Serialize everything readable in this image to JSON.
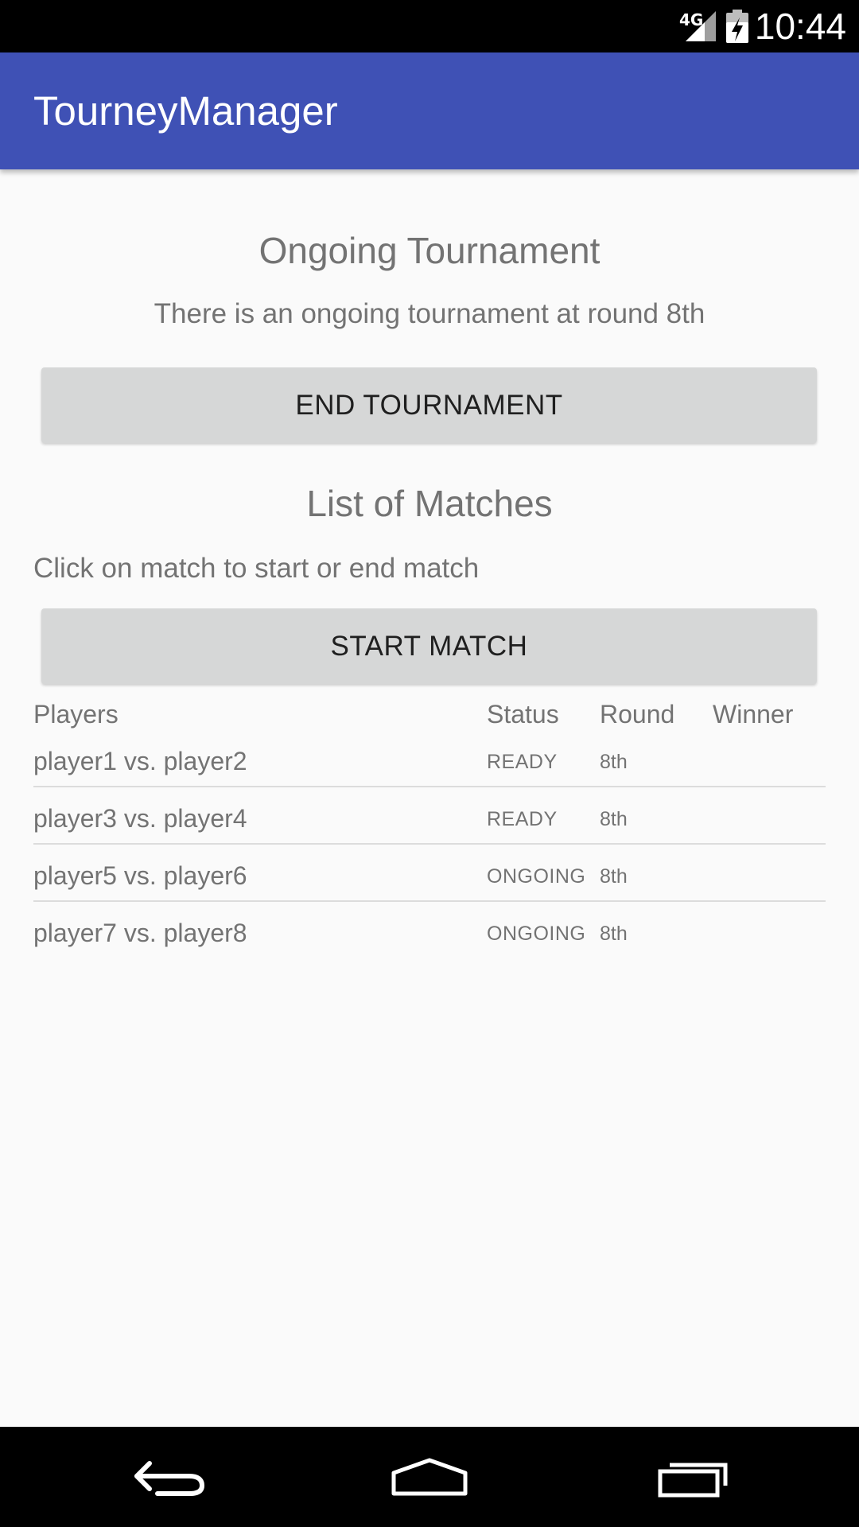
{
  "status_bar": {
    "time": "10:44",
    "network": "4G",
    "icons": [
      "signal-icon",
      "battery-icon"
    ]
  },
  "app_bar": {
    "title": "TourneyManager",
    "color": "#3f51b5"
  },
  "ongoing": {
    "title": "Ongoing Tournament",
    "description": "There is an ongoing tournament at round 8th",
    "end_button_label": "END TOURNAMENT"
  },
  "matches": {
    "title": "List of Matches",
    "hint": "Click on match to start or end match",
    "start_button_label": "START MATCH",
    "columns": {
      "players": "Players",
      "status": "Status",
      "round": "Round",
      "winner": "Winner"
    },
    "rows": [
      {
        "players": "player1 vs. player2",
        "status": "READY",
        "round": "8th",
        "winner": ""
      },
      {
        "players": "player3 vs. player4",
        "status": "READY",
        "round": "8th",
        "winner": ""
      },
      {
        "players": "player5 vs. player6",
        "status": "ONGOING",
        "round": "8th",
        "winner": ""
      },
      {
        "players": "player7 vs. player8",
        "status": "ONGOING",
        "round": "8th",
        "winner": ""
      }
    ]
  },
  "nav_bar": {
    "icons": [
      "back-icon",
      "home-icon",
      "recent-apps-icon"
    ]
  }
}
